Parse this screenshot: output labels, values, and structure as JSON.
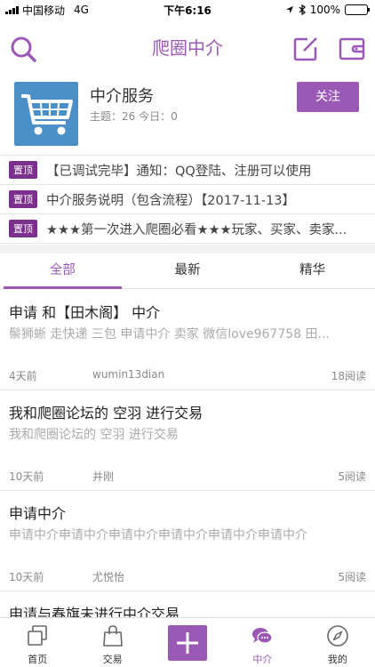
{
  "status_bar": {
    "carrier": "中国移动",
    "network": "4G",
    "time": "下午6:16",
    "battery": "100%",
    "battery_level": 1.0
  },
  "nav": {
    "title": "爬圈中介",
    "left_icon": "search-icon",
    "right_icons": [
      "edit-icon",
      "wallet-icon"
    ]
  },
  "forum": {
    "name": "中介服务",
    "stats": "主题：26  今日：0",
    "follow_label": "关注",
    "logo_icon": "shopping-cart-icon"
  },
  "pinned": [
    {
      "badge": "置顶",
      "text": "【已调试完毕】通知：QQ登陆、注册可以使用"
    },
    {
      "badge": "置顶",
      "text": "中介服务说明（包含流程）【2017-11-13】"
    },
    {
      "badge": "置顶",
      "text": "★★★第一次进入爬圈必看★★★玩家、买家、卖家..."
    }
  ],
  "tabs": [
    {
      "label": "全部",
      "active": true
    },
    {
      "label": "最新",
      "active": false
    },
    {
      "label": "精华",
      "active": false
    }
  ],
  "threads": [
    {
      "title": "申请 和【田木阁】 中介",
      "preview": "鬃狮蜥   走快递  三包  申请中介  卖家 微信love967758 田...",
      "time": "4天前",
      "author": "wumin13dian",
      "views": "18阅读"
    },
    {
      "title": "我和爬圈论坛的 空羽 进行交易",
      "preview": "我和爬圈论坛的 空羽 进行交易",
      "time": "10天前",
      "author": "井刚",
      "views": "5阅读"
    },
    {
      "title": "申请中介",
      "preview": "申请中介申请中介申请中介申请中介申请中介申请中介",
      "time": "10天前",
      "author": "尤悦怡",
      "views": "5阅读"
    },
    {
      "title": "申请与春旗未进行中介交易",
      "preview": "",
      "time": "",
      "author": "",
      "views": ""
    }
  ],
  "tab_bar": [
    {
      "label": "首页",
      "icon": "home-icon",
      "active": false
    },
    {
      "label": "交易",
      "icon": "shopping-bag-icon",
      "active": false
    },
    {
      "label": "",
      "icon": "plus-icon",
      "active": false
    },
    {
      "label": "中介",
      "icon": "chat-bubbles-icon",
      "active": true
    },
    {
      "label": "我的",
      "icon": "compass-icon",
      "active": false
    }
  ],
  "colors": {
    "accent": "#9b59b6",
    "badge": "#7d2f8e",
    "logo_bg": "#4a8fc7"
  }
}
